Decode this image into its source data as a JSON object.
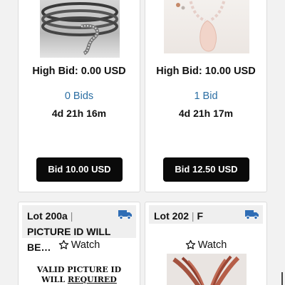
{
  "cards": [
    {
      "high_bid": "High Bid: 0.00 USD",
      "bids": "0 Bids",
      "time_left": "4d 21h 16m",
      "bid_button": "Bid 10.00 USD",
      "image_icon": "bracelet-photo"
    },
    {
      "high_bid": "High Bid: 10.00 USD",
      "bids": "1 Bid",
      "time_left": "4d 21h 17m",
      "bid_button": "Bid 12.50 USD",
      "image_icon": "pendant-necklace-photo"
    }
  ],
  "lots": [
    {
      "lot_number": "Lot 200a",
      "separator": "|",
      "description": "PICTURE ID WILL BE…",
      "watch_label": "Watch",
      "image_text_line1": "VALID PICTURE ID",
      "image_text_line2a": "WILL ",
      "image_text_line2b": "REQUIRED",
      "shipping_icon": "truck-icon"
    },
    {
      "lot_number": "Lot 202",
      "separator": "|",
      "description": "F",
      "watch_label": "Watch",
      "shipping_icon": "truck-icon"
    }
  ],
  "colors": {
    "link_blue": "#2b6ea3",
    "button_black": "#0a0a0a",
    "truck_blue": "#2f6db5",
    "header_gray": "#efefef"
  }
}
